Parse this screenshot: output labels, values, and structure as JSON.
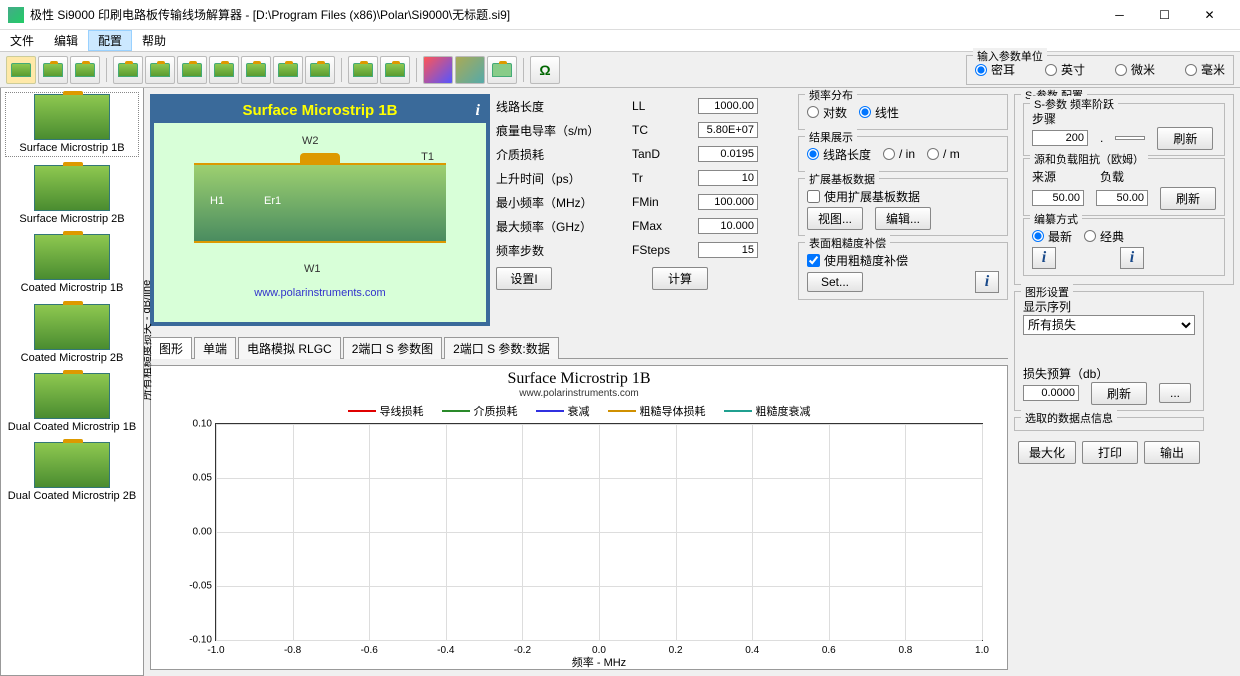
{
  "window": {
    "title": "极性 Si9000 印刷电路板传输线场解算器 - [D:\\Program Files (x86)\\Polar\\Si9000\\无标题.si9]"
  },
  "menu": {
    "items": [
      "文件",
      "编辑",
      "配置",
      "帮助"
    ],
    "selected": 2
  },
  "units": {
    "label": "输入参数单位",
    "options": [
      "密耳",
      "英寸",
      "微米",
      "毫米"
    ],
    "selected": 0
  },
  "sidebar": {
    "items": [
      "Surface Microstrip 1B",
      "Surface Microstrip 2B",
      "Coated Microstrip 1B",
      "Coated Microstrip 2B",
      "Dual Coated Microstrip 1B",
      "Dual Coated Microstrip 2B"
    ],
    "selected": 0
  },
  "diagram": {
    "title": "Surface Microstrip 1B",
    "labels": {
      "W2": "W2",
      "T1": "T1",
      "H1": "H1",
      "Er1": "Er1",
      "W1": "W1"
    },
    "url": "www.polarinstruments.com"
  },
  "params": {
    "rows": [
      {
        "label": "线路长度",
        "sym": "LL",
        "val": "1000.00"
      },
      {
        "label": "痕量电导率（s/m）",
        "sym": "TC",
        "val": "5.80E+07"
      },
      {
        "label": "介质损耗",
        "sym": "TanD",
        "val": "0.0195"
      },
      {
        "label": "上升时间（ps）",
        "sym": "Tr",
        "val": "10"
      },
      {
        "label": "最小频率（MHz）",
        "sym": "FMin",
        "val": "100.000"
      },
      {
        "label": "最大频率（GHz）",
        "sym": "FMax",
        "val": "10.000"
      },
      {
        "label": "频率步数",
        "sym": "FSteps",
        "val": "15"
      }
    ],
    "set_btn": "设置I",
    "calc_btn": "计算"
  },
  "freq_dist": {
    "label": "频率分布",
    "opts": [
      "对数",
      "线性"
    ],
    "selected": 1
  },
  "result_show": {
    "label": "结果展示",
    "opts": [
      "线路长度",
      "/ in",
      "/ m"
    ],
    "selected": 0
  },
  "ext_sub": {
    "label": "扩展基板数据",
    "check": "使用扩展基板数据",
    "btns": [
      "视图...",
      "编辑..."
    ]
  },
  "roughness": {
    "label": "表面粗糙度补偿",
    "check": "使用粗糙度补偿",
    "checked": true,
    "btn": "Set..."
  },
  "sparam": {
    "label": "S-参数 配置",
    "step_group": "S-参数 频率阶跃",
    "step_label": "步骤",
    "step_val": "200",
    "refresh": "刷新",
    "impedance_group": "源和负载阻抗（欧姆）",
    "src_label": "来源",
    "src_val": "50.00",
    "load_label": "负载",
    "load_val": "50.00"
  },
  "compile": {
    "label": "编纂方式",
    "opts": [
      "最新",
      "经典"
    ],
    "selected": 0
  },
  "tabs": {
    "items": [
      "图形",
      "单端",
      "电路模拟 RLGC",
      "2端口 S 参数图",
      "2端口 S 参数:数据"
    ],
    "selected": 0
  },
  "chart_data": {
    "type": "line",
    "title": "Surface Microstrip 1B",
    "subtitle": "www.polarinstruments.com",
    "xlabel": "频率 - MHz",
    "ylabel": "所有粗糙度损失 - dB/line",
    "xlim": [
      -1.0,
      1.0
    ],
    "ylim": [
      -0.1,
      0.1
    ],
    "xticks": [
      -1.0,
      -0.8,
      -0.6,
      -0.4,
      -0.2,
      0.0,
      0.2,
      0.4,
      0.6,
      0.8,
      1.0
    ],
    "yticks": [
      -0.1,
      -0.05,
      0.0,
      0.05,
      0.1
    ],
    "series": [
      {
        "name": "导线损耗",
        "color": "#e00000",
        "values": []
      },
      {
        "name": "介质损耗",
        "color": "#2a8a2a",
        "values": []
      },
      {
        "name": "衰减",
        "color": "#3030e0",
        "values": []
      },
      {
        "name": "粗糙导体损耗",
        "color": "#d09000",
        "values": []
      },
      {
        "name": "粗糙度衰减",
        "color": "#20a090",
        "values": []
      }
    ]
  },
  "graph_settings": {
    "label": "图形设置",
    "show_series": "显示序列",
    "show_series_val": "所有损失",
    "loss_budget": "损失预算（db）",
    "loss_budget_val": "0.0000",
    "refresh": "刷新",
    "more": "...",
    "datapoint": "选取的数据点信息"
  },
  "bottom": {
    "max": "最大化",
    "print": "打印",
    "export": "输出"
  }
}
